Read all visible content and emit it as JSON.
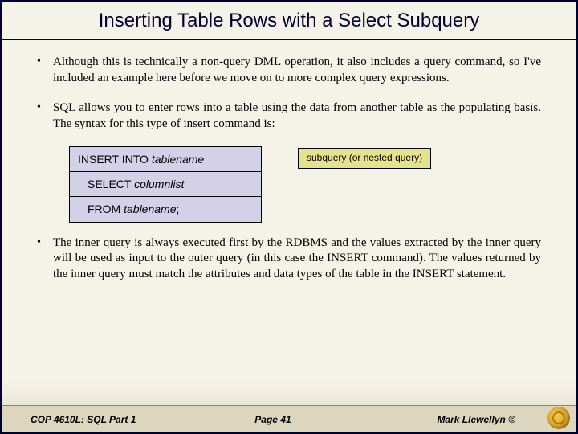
{
  "title": "Inserting Table Rows with a Select Subquery",
  "bullets": {
    "b1": "Although this is technically a non-query DML operation, it also includes a query command, so I've included an example here before we move on to more complex query expressions.",
    "b2": "SQL allows you to enter rows into a table using the data from another table as the populating basis.  The syntax for this type of insert command is:",
    "b3": "The inner query is always executed first by the RDBMS and the values extracted by the inner query will be used as input to the outer query (in this case the INSERT command).  The values returned by the inner query must match the attributes and data types of the table in the INSERT statement."
  },
  "syntax": {
    "line1_kw": "INSERT INTO ",
    "line1_it": "tablename",
    "line2_kw": "SELECT ",
    "line2_it": "columnlist",
    "line3_kw": "FROM  ",
    "line3_it": "tablename",
    "line3_end": ";"
  },
  "callout": "subquery (or nested query)",
  "footer": {
    "left": "COP 4610L: SQL Part 1",
    "mid": "Page 41",
    "right": "Mark Llewellyn ©"
  }
}
